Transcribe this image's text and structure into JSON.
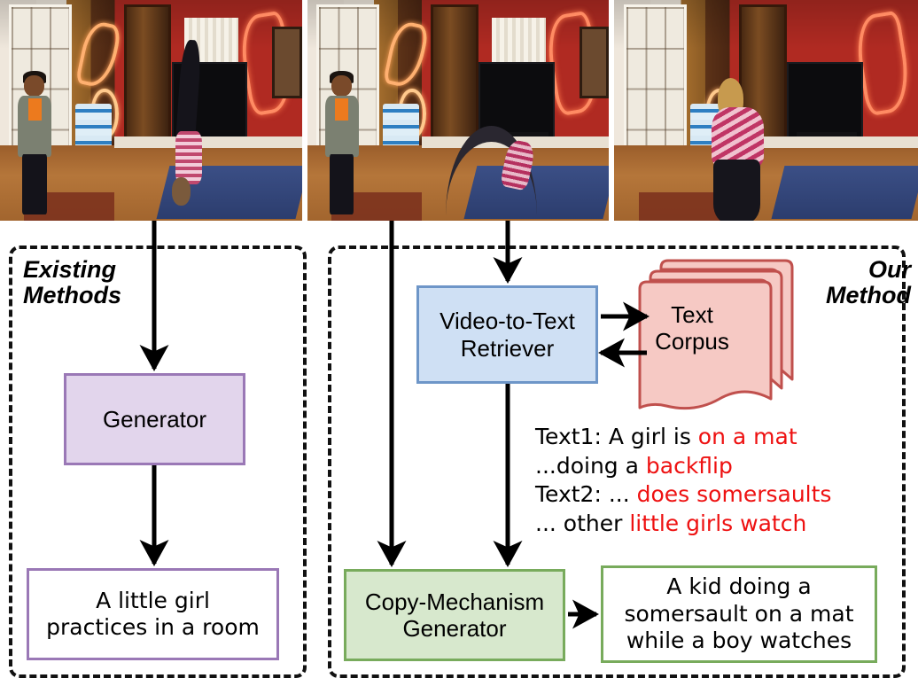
{
  "figure": {
    "panels": {
      "left": {
        "label": "Existing\nMethods"
      },
      "right": {
        "label": "Our\nMethod"
      }
    },
    "video_frames": [
      {
        "name": "frame-1",
        "caption_alt": "A girl doing a handstand on a mat in a red living room while a boy watches"
      },
      {
        "name": "frame-2",
        "caption_alt": "The girl in a backbend bridge pose on the mat while the boy stands watching"
      },
      {
        "name": "frame-3",
        "caption_alt": "Close view of the girl kneeling on the blue mat in striped pink shirt"
      }
    ],
    "boxes": {
      "generator": "Generator",
      "retriever": "Video-to-Text\nRetriever",
      "corpus": "Text\nCorpus",
      "copy_generator": "Copy-Mechanism\nGenerator",
      "existing_caption": "A little girl\npractices in a room",
      "our_caption": "A kid doing a\nsomersault on a mat\nwhile a boy watches"
    },
    "retrieved_texts": [
      {
        "prefix": "Text1: A girl is ",
        "highlight": "on a mat"
      },
      {
        "prefix": "...doing a ",
        "highlight": "backflip"
      },
      {
        "prefix": "Text2: ... ",
        "highlight": "does somersaults"
      },
      {
        "prefix": "... other ",
        "highlight": "little girls watch"
      }
    ],
    "colors": {
      "purple_fill": "#e2d5ec",
      "purple_border": "#9a78b6",
      "blue_fill": "#cfe0f4",
      "blue_border": "#6e96c8",
      "green_fill": "#d7e8cd",
      "green_border": "#78ab5c",
      "corpus_fill": "#f6c9c4",
      "corpus_border": "#c0504d",
      "highlight_red": "#ee1111",
      "dashed_border": "#111111"
    }
  }
}
